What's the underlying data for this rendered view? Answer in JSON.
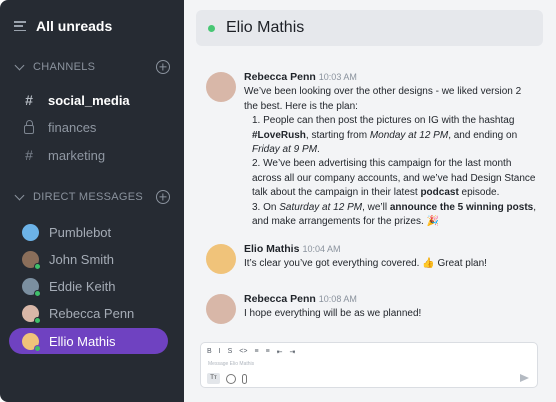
{
  "sidebar": {
    "header": "All unreads",
    "channels_title": "CHANNELS",
    "channels": [
      {
        "name": "social_media",
        "icon": "hash-icon"
      },
      {
        "name": "finances",
        "icon": "lock-icon"
      },
      {
        "name": "marketing",
        "icon": "hash-icon"
      }
    ],
    "dm_title": "DIRECT MESSAGES",
    "dms": [
      {
        "name": "Pumblebot",
        "color": "#6cb3e8"
      },
      {
        "name": "John Smith",
        "color": "#8a6e5a"
      },
      {
        "name": "Eddie Keith",
        "color": "#7b8fa0"
      },
      {
        "name": "Rebecca Penn",
        "color": "#d8b7a8"
      },
      {
        "name": "Ellio Mathis",
        "color": "#f0c37a"
      }
    ]
  },
  "header": {
    "title": "Elio Mathis"
  },
  "messages": [
    {
      "author": "Rebecca Penn",
      "time": "10:03 AM",
      "avatar_color": "#d8b7a8",
      "lines": {
        "intro": "We’ve been looking over the other designs - we liked version 2 the best. Here is the plan:",
        "p1_a": "1. People can then post the pictures on IG with the hashtag ",
        "p1_tag": "#LoveRush",
        "p1_b": ", starting from ",
        "p1_start": "Monday at 12 PM",
        "p1_c": ", and ending on ",
        "p1_end": "Friday at 9 PM",
        "p1_d": ".",
        "p2_a": "2. We’ve been advertising this campaign for the last month across all our company accounts, and we’ve had Design Stance talk about the campaign in their latest ",
        "p2_bold": "podcast",
        "p2_b": " episode.",
        "p3_a": "3. On ",
        "p3_when": "Saturday at 12 PM",
        "p3_b": ", we’ll ",
        "p3_bold": "announce the 5 winning posts",
        "p3_c": ", and make arrangements for the prizes. 🎉"
      }
    },
    {
      "author": "Elio Mathis",
      "time": "10:04 AM",
      "avatar_color": "#f0c37a",
      "text": "It’s clear you’ve got everything covered. 👍 Great plan!"
    },
    {
      "author": "Rebecca Penn",
      "time": "10:08 AM",
      "avatar_color": "#d8b7a8",
      "text": "I hope everything will be as we planned!"
    }
  ],
  "composer": {
    "placeholder": "Message Elio Mathis",
    "format_buttons": [
      "B",
      "I",
      "S",
      "<>",
      "≡",
      "≡",
      "⇤",
      "⇥"
    ],
    "tt_label": "Tт"
  }
}
